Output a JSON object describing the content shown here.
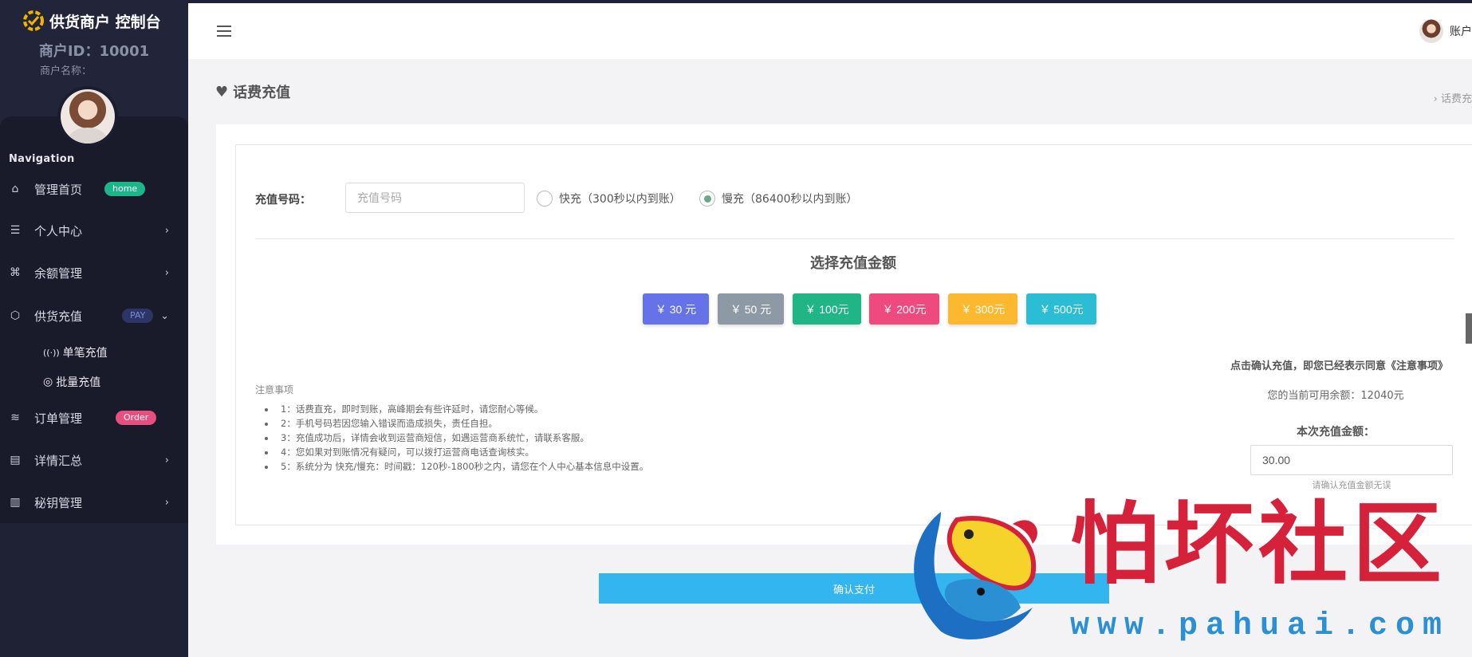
{
  "sidebar": {
    "brand": "供货商户 控制台",
    "merchant_id": "商户ID：10001",
    "merchant_name": "商户名称：",
    "nav_title": "Navigation",
    "items": [
      {
        "label": "管理首页",
        "badge": "home"
      },
      {
        "label": "个人中心"
      },
      {
        "label": "余额管理"
      },
      {
        "label": "供货充值",
        "badge": "PAY"
      },
      {
        "label": "订单管理",
        "badge": "Order"
      },
      {
        "label": "详情汇总"
      },
      {
        "label": "秘钥管理"
      }
    ],
    "subitems": [
      {
        "label": "单笔充值"
      },
      {
        "label": "批量充值"
      }
    ]
  },
  "header": {
    "user_label": "账户"
  },
  "page": {
    "title": "话费充值",
    "breadcrumb": "›   话费充"
  },
  "form": {
    "phone_label": "充值号码：",
    "phone_placeholder": "充值号码",
    "radio_fast": "快充（300秒以内到账）",
    "radio_slow": "慢充（86400秒以内到账）",
    "choose_title": "选择充值金额",
    "amounts": [
      {
        "label": "￥ 30 元",
        "color": "#6672e8"
      },
      {
        "label": "￥ 50 元",
        "color": "#8e99a6"
      },
      {
        "label": "￥ 100元",
        "color": "#1fb585"
      },
      {
        "label": "￥ 200元",
        "color": "#ef4a7f"
      },
      {
        "label": "￥ 300元",
        "color": "#fcb82f"
      },
      {
        "label": "￥ 500元",
        "color": "#2bbdd3"
      }
    ],
    "notes_title": "注意事项",
    "notes": [
      "1：话费直充，即时到账，高峰期会有些许延时，请您耐心等候。",
      "2：手机号码若因您输入错误而造成损失，责任自担。",
      "3：充值成功后，详情会收到运营商短信，如遇运营商系统忙，请联系客服。",
      "4：您如果对到账情况有疑问，可以拨打运营商电话查询核实。",
      "5：系统分为 快充/慢充：时间戳：120秒-1800秒之内，请您在个人中心基本信息中设置。"
    ],
    "agree_text": "点击确认充值，即您已经表示同意《注意事项》",
    "balance_text": "您的当前可用余额：12040元",
    "amount_label": "本次充值金额：",
    "amount_value": "30.00",
    "amount_hint": "请确认充值金额无误",
    "pay_button": "确认支付"
  },
  "watermark": {
    "text": "怕坏社区",
    "url": "www.pahuai.com"
  }
}
